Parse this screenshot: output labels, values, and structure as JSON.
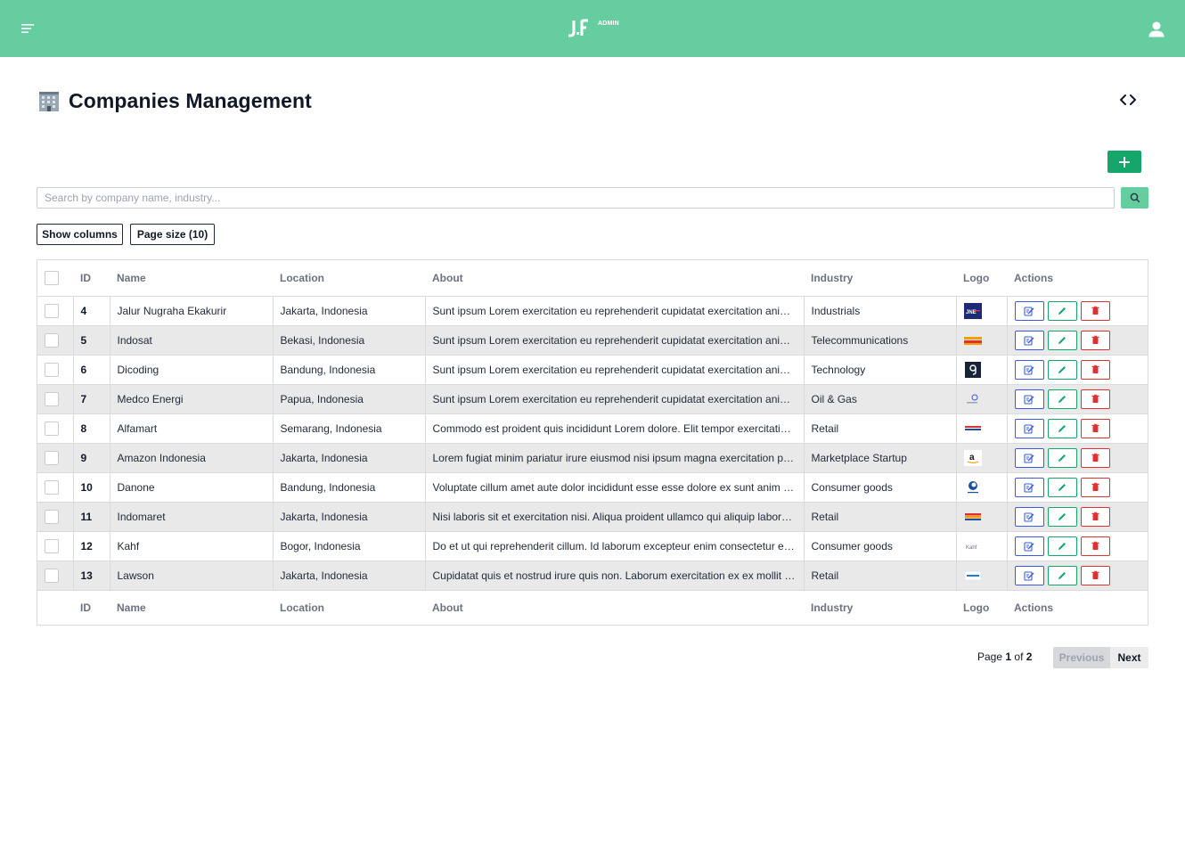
{
  "header": {
    "logo_text": "J.F",
    "badge": "ADMIN",
    "menu_icon": "menu-icon",
    "user_icon": "user-icon"
  },
  "page": {
    "title": "Companies Management",
    "title_icon": "office-building-emoji",
    "code_icon": "code-brackets-icon"
  },
  "toolbar": {
    "add_icon": "plus-icon",
    "search_placeholder": "Search by company name, industry...",
    "search_value": "",
    "search_icon": "search-icon",
    "show_columns_label": "Show columns",
    "page_size_label": "Page size (10)"
  },
  "table": {
    "columns": [
      "ID",
      "Name",
      "Location",
      "About",
      "Industry",
      "Logo",
      "Actions"
    ],
    "footer_columns": [
      "ID",
      "Name",
      "Location",
      "About",
      "Industry",
      "Logo",
      "Actions"
    ],
    "rows": [
      {
        "id": "4",
        "name": "Jalur Nugraha Ekakurir",
        "location": "Jakarta, Indonesia",
        "about": "Sunt ipsum Lorem exercitation eu reprehenderit cupidatat exercitation ani…",
        "industry": "Industrials",
        "logo": "jne-logo"
      },
      {
        "id": "5",
        "name": "Indosat",
        "location": "Bekasi, Indonesia",
        "about": "Sunt ipsum Lorem exercitation eu reprehenderit cupidatat exercitation ani…",
        "industry": "Telecommunications",
        "logo": "indosat-logo"
      },
      {
        "id": "6",
        "name": "Dicoding",
        "location": "Bandung, Indonesia",
        "about": "Sunt ipsum Lorem exercitation eu reprehenderit cupidatat exercitation ani…",
        "industry": "Technology",
        "logo": "dicoding-logo"
      },
      {
        "id": "7",
        "name": "Medco Energi",
        "location": "Papua, Indonesia",
        "about": "Sunt ipsum Lorem exercitation eu reprehenderit cupidatat exercitation ani…",
        "industry": "Oil & Gas",
        "logo": "medco-logo"
      },
      {
        "id": "8",
        "name": "Alfamart",
        "location": "Semarang, Indonesia",
        "about": "Commodo est proident quis incididunt Lorem dolore. Elit tempor exercitatio…",
        "industry": "Retail",
        "logo": "alfamart-logo"
      },
      {
        "id": "9",
        "name": "Amazon Indonesia",
        "location": "Jakarta, Indonesia",
        "about": "Lorem fugiat minim pariatur irure eiusmod nisi ipsum magna exercitation p…",
        "industry": "Marketplace Startup",
        "logo": "amazon-logo"
      },
      {
        "id": "10",
        "name": "Danone",
        "location": "Bandung, Indonesia",
        "about": "Voluptate cillum amet aute dolor incididunt esse esse dolore ex sunt anim i…",
        "industry": "Consumer goods",
        "logo": "danone-logo"
      },
      {
        "id": "11",
        "name": "Indomaret",
        "location": "Jakarta, Indonesia",
        "about": "Nisi laboris sit et exercitation nisi. Aliqua proident ullamco qui aliquip labor…",
        "industry": "Retail",
        "logo": "indomaret-logo"
      },
      {
        "id": "12",
        "name": "Kahf",
        "location": "Bogor, Indonesia",
        "about": "Do et ut qui reprehenderit cillum. Id laborum excepteur enim consectetur eli…",
        "industry": "Consumer goods",
        "logo": "kahf-logo"
      },
      {
        "id": "13",
        "name": "Lawson",
        "location": "Jakarta, Indonesia",
        "about": "Cupidatat quis et nostrud irure quis non. Laborum exercitation ex ex mollit i…",
        "industry": "Retail",
        "logo": "lawson-logo"
      }
    ],
    "action_icons": [
      "view-details-icon",
      "edit-pencil-icon",
      "trash-icon"
    ]
  },
  "pagination": {
    "prefix": "Page",
    "current": "1",
    "of": "of",
    "total": "2",
    "previous_label": "Previous",
    "next_label": "Next"
  },
  "colors": {
    "header_bg": "#66cda1",
    "primary_green": "#15a66b",
    "view_blue": "#3b5bdb",
    "delete_red": "#e03131",
    "row_alt": "#e9e9ea"
  }
}
